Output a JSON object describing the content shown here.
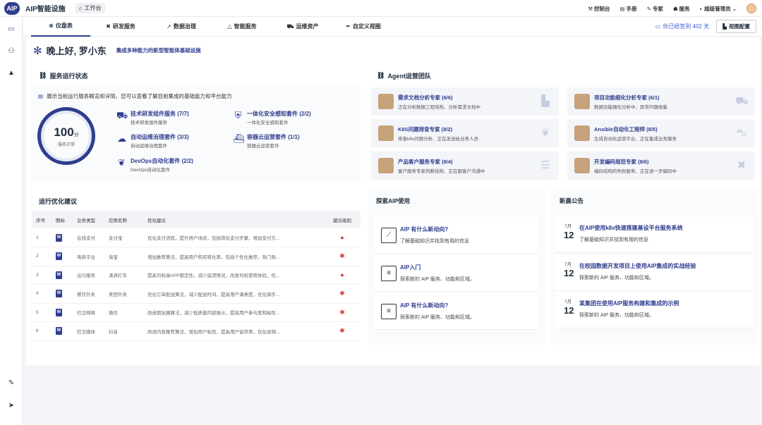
{
  "app": {
    "logo": "AIP",
    "name": "AIP智能设施",
    "workbench": "工作台"
  },
  "topbar": {
    "items": [
      "控制台",
      "手册",
      "专家",
      "服务",
      "超级管理员"
    ]
  },
  "nav": {
    "tabs": [
      "仪盘表",
      "研发服务",
      "数据治理",
      "智能服务",
      "运维资产",
      "自定义视图"
    ],
    "signin": "你已经签到 402 天",
    "view_config": "视图配置"
  },
  "greeting": {
    "hello": "晚上好, 罗小东",
    "subtitle": "集成多种能力的新型智能体基础设施"
  },
  "service": {
    "title": "服务运行状态",
    "desc": "展示当前运行服务概览和详情，您可以查看了解目前集成的基础能力和平台能力",
    "score": "100",
    "score_unit": "分",
    "status": "服务正常",
    "items": [
      {
        "title": "技术研发组件服务 (7/7)",
        "desc": "技术研发组件服务",
        "icon": "truck-icon"
      },
      {
        "title": "一体化安全感知套件 (2/2)",
        "desc": "一体化安全感知套件",
        "icon": "shield-icon"
      },
      {
        "title": "自动运维治理套件 (3/3)",
        "desc": "自动运维治理套件",
        "icon": "brain-icon"
      },
      {
        "title": "容器云运营套件 (1/1)",
        "desc": "容器云运营套件",
        "icon": "ship-icon"
      },
      {
        "title": "DevOps自动化套件 (2/2)",
        "desc": "DevOps自动化套件",
        "icon": "leaf-icon"
      }
    ]
  },
  "agents": {
    "title": "Agent运营团队",
    "items": [
      {
        "title": "需求文档分析专家 (6/6)",
        "desc": "正在分析数据工程结构、分析需求文档中"
      },
      {
        "title": "项目功能细化分析专家 (6/1)",
        "desc": "数据功能细化分析中、异常问题收集"
      },
      {
        "title": "K8S问题排查专家 (8/2)",
        "desc": "排查k8s问题分析、正在发送给业务人员"
      },
      {
        "title": "Ansible自动化工程师 (8/5)",
        "desc": "生成自动化运营平台、正在集成业务服务"
      },
      {
        "title": "产品客户服务专家 (8/4)",
        "desc": "客户服务专家判断结构、正在跟客户沟通中"
      },
      {
        "title": "开发编码规范专家 (8/6)",
        "desc": "编码结构的失败服务、正在进一步编码中"
      }
    ]
  },
  "optimize": {
    "title": "运行优化建议",
    "headers": [
      "序号",
      "图标",
      "业务类型",
      "应用名称",
      "优化建议",
      "建议级别"
    ],
    "rows": [
      {
        "no": "1",
        "type": "在线支付",
        "app": "支付宝",
        "advice": "优化支付流程，提升用户体验，包括简化支付步骤，增加支付方..."
      },
      {
        "no": "2",
        "type": "电商平台",
        "app": "淘宝",
        "advice": "增加推荐算法，提高用户购买转化率，包括个性化推荐，热门商..."
      },
      {
        "no": "3",
        "type": "出行服务",
        "app": "滴滴打车",
        "advice": "提高司机端APP稳定性，减少崩溃情况，改善司机使用体验，优..."
      },
      {
        "no": "4",
        "type": "餐饮外卖",
        "app": "美团外卖",
        "advice": "优化订单配送算法，减少配送时间，提高用户满意度，优化骑手..."
      },
      {
        "no": "5",
        "type": "社交网络",
        "app": "微信",
        "advice": "改进朋友圈算法，减少低质量内容展示，提高用户参与度和粘性..."
      },
      {
        "no": "6",
        "type": "社交媒体",
        "app": "抖音",
        "advice": "改进内容推荐算法，增加用户粘性，提高用户留存率，优化视频..."
      }
    ]
  },
  "explore": {
    "title": "探索AIP使用",
    "items": [
      {
        "title": "AIP 有什么新动向?",
        "desc": "了解基础知识并找到有用的信息"
      },
      {
        "title": "AIP入门",
        "desc": "探索新的 AIP 服务、功能和区域。"
      },
      {
        "title": "AIP 有什么新动向?",
        "desc": "探索新的 AIP 服务、功能和区域。"
      }
    ]
  },
  "news": {
    "title": "新晨公告",
    "items": [
      {
        "month": "7月",
        "day": "12",
        "title": "在AIP使用k8s快速搭建基设平台服务系统",
        "desc": "了解基础知识并找到有用的信息"
      },
      {
        "month": "7月",
        "day": "12",
        "title": "在校园数据开发项目上使用AIP集成的实战经验",
        "desc": "探索新的 AIP 服务、功能和区域。"
      },
      {
        "month": "7月",
        "day": "12",
        "title": "某集团在使用AIP服务构建和集成的示例",
        "desc": "探索新的 AIP 服务、功能和区域。"
      }
    ]
  },
  "colors": {
    "brand": "#2f3d8f",
    "link": "#3c5fd6",
    "alert": "#d93a3a"
  }
}
